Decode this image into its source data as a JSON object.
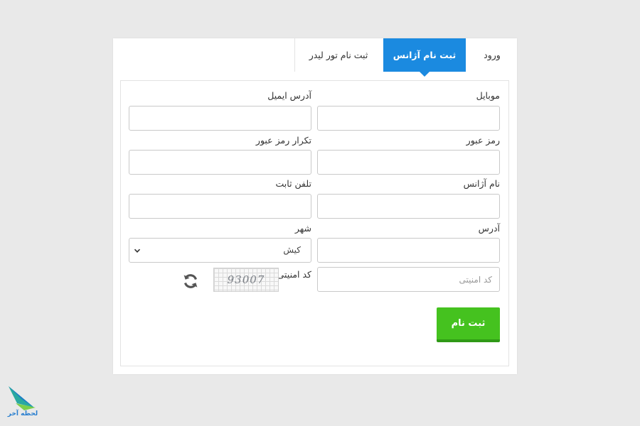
{
  "tabs": {
    "login": "ورود",
    "agency": "ثبت نام آژانس",
    "leader": "ثبت نام تور لیدر"
  },
  "form": {
    "mobile_label": "موبایل",
    "email_label": "آدرس ایمیل",
    "password_label": "رمز عبور",
    "password_repeat_label": "تکرار رمز عبور",
    "agency_name_label": "نام آژانس",
    "phone_label": "تلفن ثابت",
    "address_label": "آدرس",
    "city_label": "شهر",
    "city_value": "کیش",
    "captcha_label": "کد امنیتی",
    "captcha_placeholder": "کد امنیتی",
    "captcha_code": "93007",
    "submit_label": "ثبت نام"
  },
  "logo": {
    "text": "لحظه آخر"
  },
  "colors": {
    "accent": "#1b8ae0",
    "submit": "#45c21f",
    "submit_shadow": "#2f9a16"
  }
}
